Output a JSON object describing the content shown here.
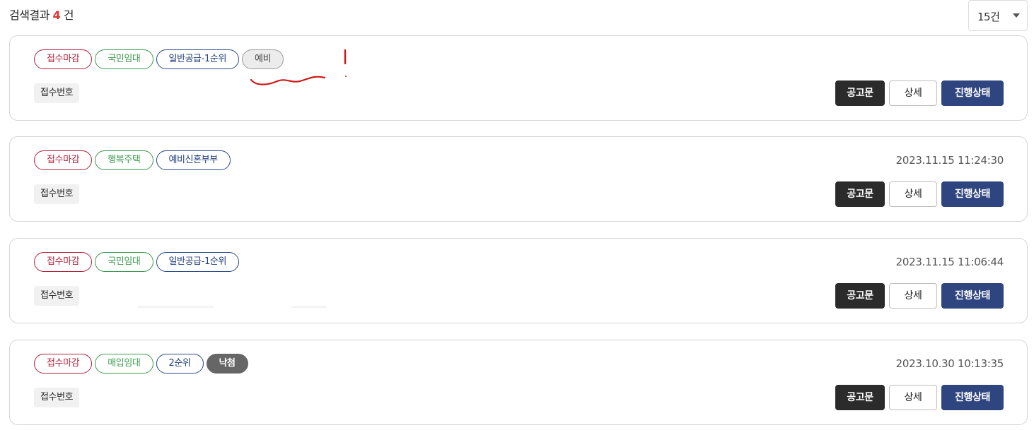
{
  "header": {
    "result_prefix": "검색결과",
    "result_count": "4",
    "result_suffix": "건",
    "page_size": "15건"
  },
  "cards": [
    {
      "tags": [
        "접수마감",
        "국민임대",
        "일반공급-1순위",
        "예비"
      ],
      "timestamp": "",
      "receipt_label": "접수번호",
      "buttons": {
        "notice": "공고문",
        "detail": "상세",
        "status": "진행상태"
      }
    },
    {
      "tags": [
        "접수마감",
        "행복주택",
        "예비신혼부부"
      ],
      "timestamp": "2023.11.15 11:24:30",
      "receipt_label": "접수번호",
      "buttons": {
        "notice": "공고문",
        "detail": "상세",
        "status": "진행상태"
      }
    },
    {
      "tags": [
        "접수마감",
        "국민임대",
        "일반공급-1순위"
      ],
      "timestamp": "2023.11.15 11:06:44",
      "receipt_label": "접수번호",
      "buttons": {
        "notice": "공고문",
        "detail": "상세",
        "status": "진행상태"
      }
    },
    {
      "tags": [
        "접수마감",
        "매입임대",
        "2순위",
        "낙첨"
      ],
      "timestamp": "2023.10.30 10:13:35",
      "receipt_label": "접수번호",
      "buttons": {
        "notice": "공고문",
        "detail": "상세",
        "status": "진행상태"
      }
    }
  ],
  "colors": {
    "tag_status_red": "#b3213b",
    "tag_type_green": "#3b9a4e",
    "tag_supply_navy": "#2b4a8a",
    "btn_status_bg": "#2f4580",
    "btn_notice_bg": "#2b2b2b",
    "count_red": "#e03131",
    "annotation_red": "#d01818"
  }
}
